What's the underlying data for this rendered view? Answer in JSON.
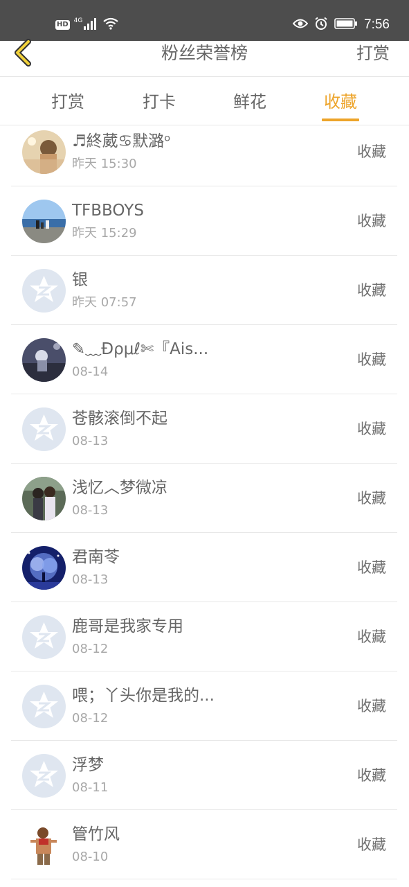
{
  "status_bar": {
    "hd_label": "HD",
    "network_label": "4G",
    "time": "7:56",
    "icons": [
      "hd-icon",
      "signal-icon",
      "wifi-icon",
      "eye-icon",
      "alarm-icon",
      "battery-icon"
    ]
  },
  "nav": {
    "back_icon": "chevron-left-icon",
    "title": "粉丝荣誉榜",
    "right_label": "打赏",
    "accent_color": "#f2d23a"
  },
  "tabs": {
    "items": [
      {
        "label": "打赏"
      },
      {
        "label": "打卡"
      },
      {
        "label": "鲜花"
      },
      {
        "label": "收藏"
      }
    ],
    "active": "收藏",
    "accent_color": "#eda42a"
  },
  "list": {
    "items": [
      {
        "name": "♬終葳♋默潞ᵒ",
        "time": "昨天 15:30",
        "action": "收藏",
        "avatar": "photo-girl-avatar"
      },
      {
        "name": "TFBBOYS",
        "time": "昨天 15:29",
        "action": "收藏",
        "avatar": "photo-beach-avatar"
      },
      {
        "name": "银",
        "time": "昨天 07:57",
        "action": "收藏",
        "avatar": "default-qzone-avatar"
      },
      {
        "name": "✎﹏Ðρμℓ✄『Ais...",
        "time": "08-14",
        "action": "收藏",
        "avatar": "photo-scenery-avatar"
      },
      {
        "name": "苍骸滚倒不起",
        "time": "08-13",
        "action": "收藏",
        "avatar": "default-qzone-avatar"
      },
      {
        "name": "浅忆︿梦微凉",
        "time": "08-13",
        "action": "收藏",
        "avatar": "photo-couple-avatar"
      },
      {
        "name": "君南苓",
        "time": "08-13",
        "action": "收藏",
        "avatar": "photo-night-tree-avatar"
      },
      {
        "name": "鹿哥是我家专用",
        "time": "08-12",
        "action": "收藏",
        "avatar": "default-qzone-avatar"
      },
      {
        "name": "喂；丫头你是我的...",
        "time": "08-12",
        "action": "收藏",
        "avatar": "default-qzone-avatar"
      },
      {
        "name": "浮梦",
        "time": "08-11",
        "action": "收藏",
        "avatar": "default-qzone-avatar"
      },
      {
        "name": "管竹风",
        "time": "08-10",
        "action": "收藏",
        "avatar": "photo-man-avatar"
      }
    ]
  }
}
